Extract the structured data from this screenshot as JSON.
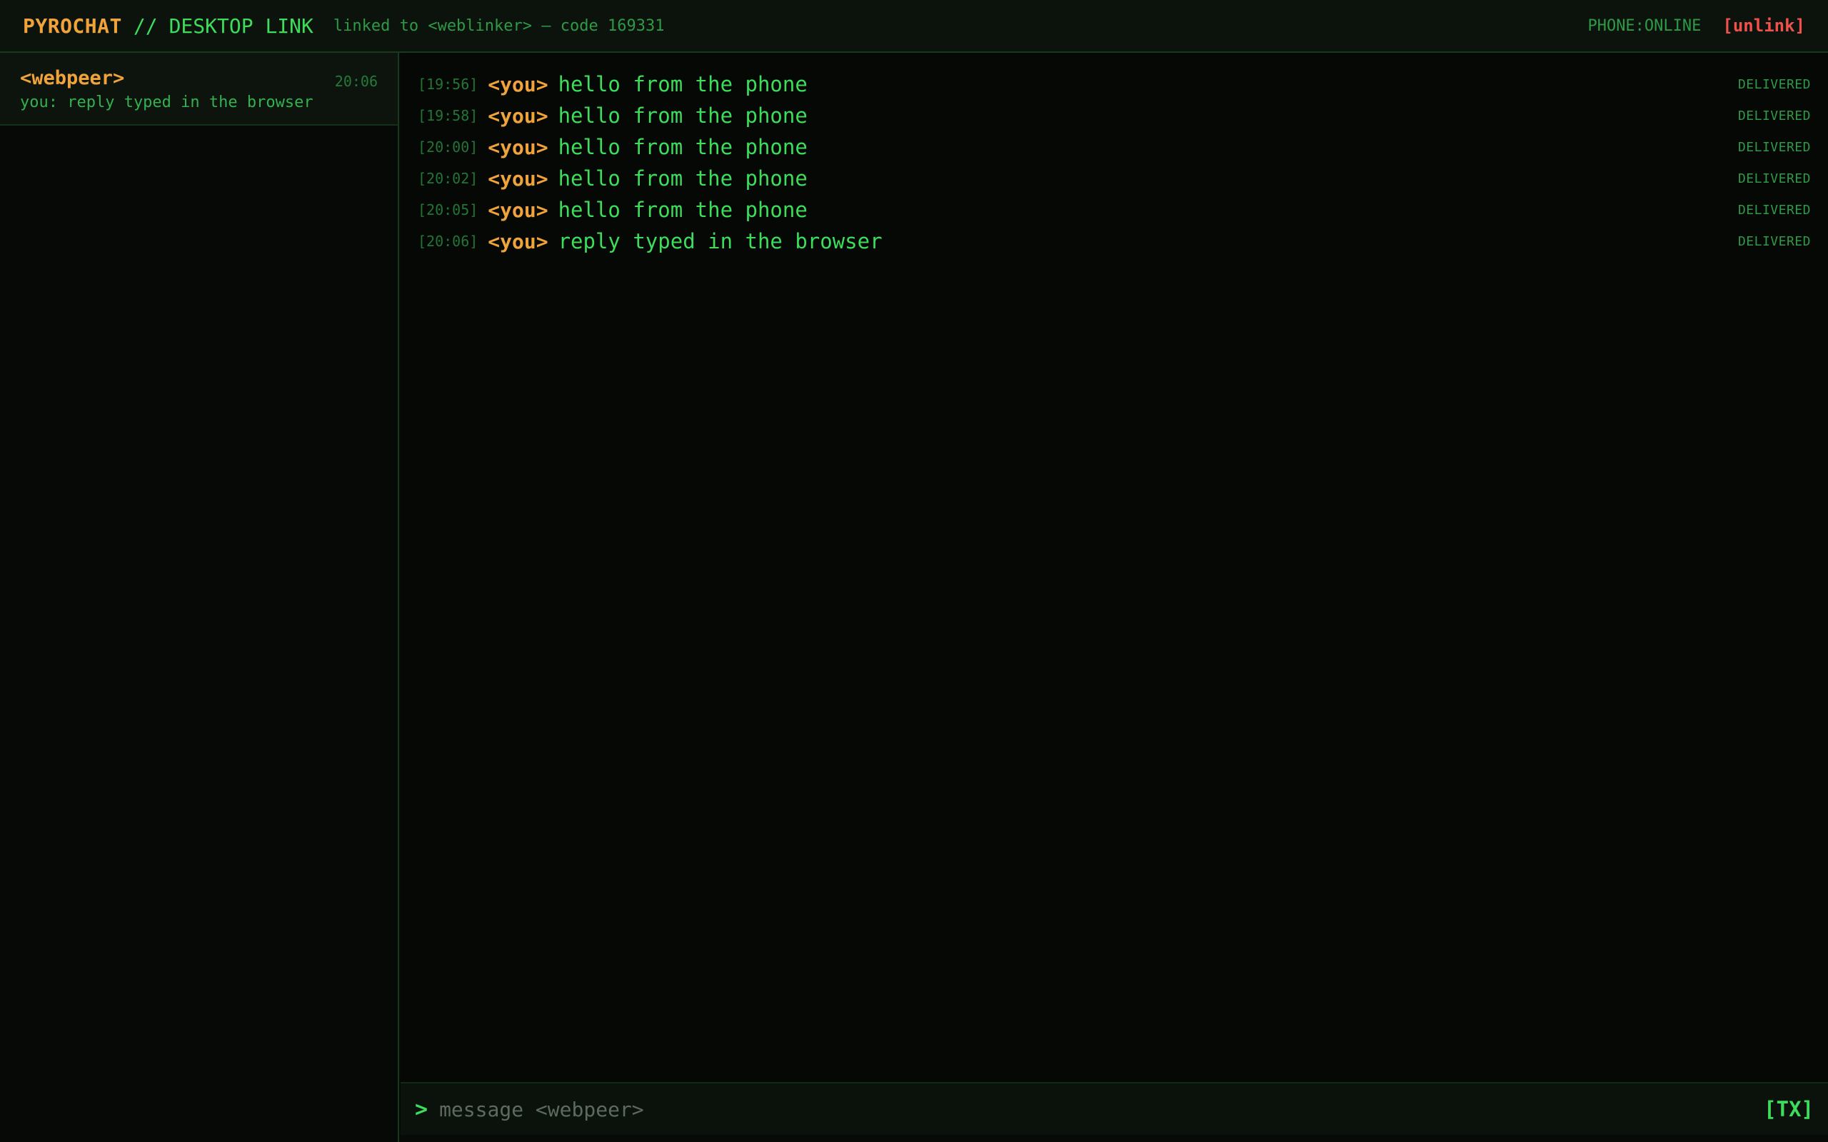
{
  "header": {
    "brand": "PYROCHAT",
    "separator": "//",
    "subtitle": "DESKTOP LINK",
    "link_info": "linked to <weblinker> — code 169331",
    "phone_status": "PHONE:ONLINE",
    "unlink_label": "[unlink]"
  },
  "sidebar": {
    "conversations": [
      {
        "name": "<webpeer>",
        "time": "20:06",
        "preview": "you: reply typed in the browser"
      }
    ]
  },
  "chat": {
    "messages": [
      {
        "time": "[19:56]",
        "author": "<you>",
        "text": "hello from the phone",
        "status": "DELIVERED"
      },
      {
        "time": "[19:58]",
        "author": "<you>",
        "text": "hello from the phone",
        "status": "DELIVERED"
      },
      {
        "time": "[20:00]",
        "author": "<you>",
        "text": "hello from the phone",
        "status": "DELIVERED"
      },
      {
        "time": "[20:02]",
        "author": "<you>",
        "text": "hello from the phone",
        "status": "DELIVERED"
      },
      {
        "time": "[20:05]",
        "author": "<you>",
        "text": "hello from the phone",
        "status": "DELIVERED"
      },
      {
        "time": "[20:06]",
        "author": "<you>",
        "text": "reply typed in the browser",
        "status": "DELIVERED"
      }
    ]
  },
  "composer": {
    "prompt": ">",
    "placeholder": "message <webpeer>",
    "value": "",
    "send_label": "[TX]"
  },
  "colors": {
    "accent_orange": "#f0a33a",
    "accent_green": "#3ddc5a",
    "danger_red": "#f0524b",
    "background": "#070a07"
  }
}
